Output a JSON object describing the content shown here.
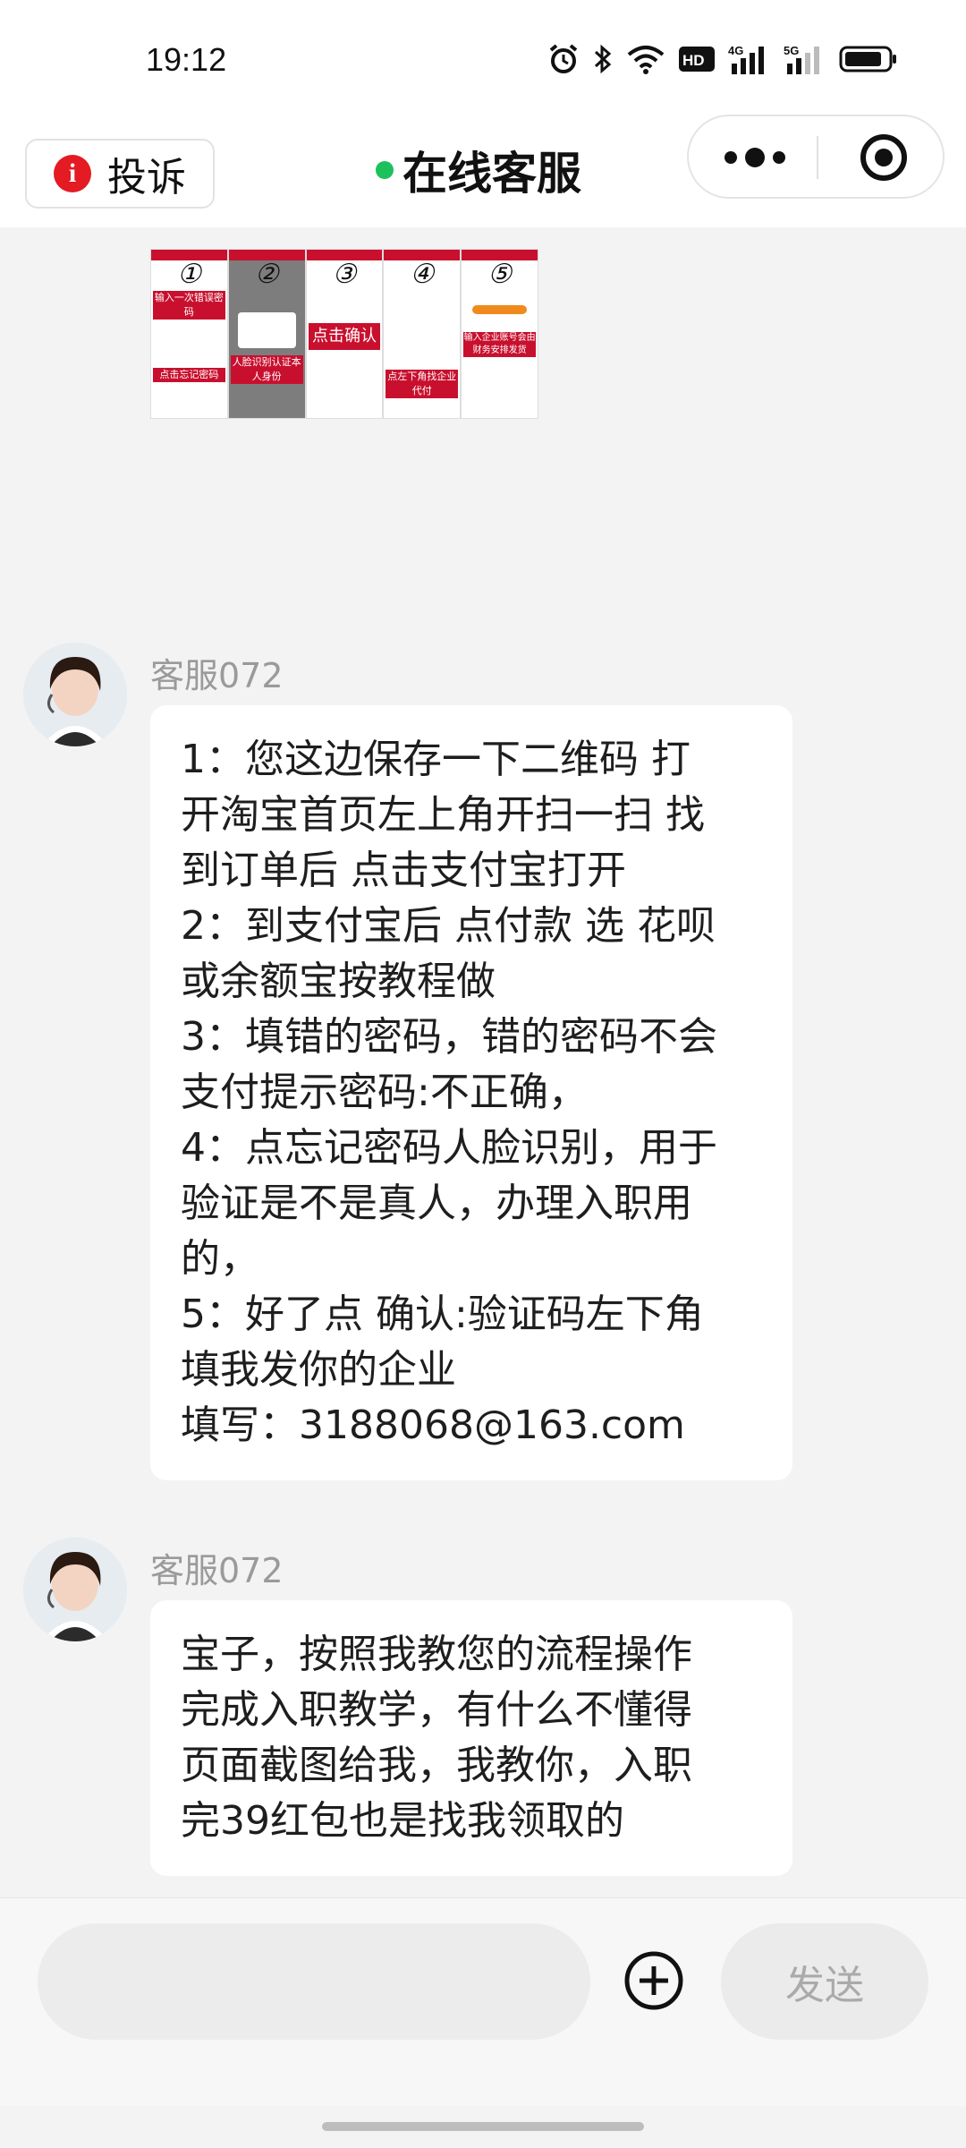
{
  "status_bar": {
    "time": "19:12",
    "icons": [
      "alarm-icon",
      "bluetooth-icon",
      "wifi-icon",
      "hd-icon",
      "signal-4g-icon",
      "signal-5g-icon",
      "battery-icon"
    ],
    "hd_label": "HD",
    "net1": "4G",
    "net2": "5G"
  },
  "header": {
    "complain_label": "投诉",
    "title": "在线客服",
    "online_color": "#1dc15b"
  },
  "tutorial_image": {
    "steps": [
      {
        "num": "①",
        "caption_top": "输入一次错误密码",
        "caption_bottom": "点击忘记密码"
      },
      {
        "num": "②",
        "caption_top": "",
        "caption_bottom": "人脸识别认证本人身份"
      },
      {
        "num": "③",
        "caption_top": "点击确认",
        "caption_bottom": ""
      },
      {
        "num": "④",
        "caption_top": "",
        "caption_bottom": "点左下角找企业代付"
      },
      {
        "num": "⑤",
        "caption_top": "输入企业账号会由财务安排发货",
        "caption_bottom": ""
      }
    ]
  },
  "messages": [
    {
      "sender": "客服072",
      "lines": [
        "1：您这边保存一下二维码 打",
        "开淘宝首页左上角开扫一扫 找",
        "到订单后 点击支付宝打开",
        "2：到支付宝后 点付款 选 花呗",
        "或余额宝按教程做",
        "3：填错的密码，错的密码不会",
        "支付提示密码:不正确，",
        "4：点忘记密码人脸识别，用于",
        "验证是不是真人，办理入职用",
        "的，",
        "5：好了点 确认:验证码左下角",
        "填我发你的企业",
        "填写：3188068@163.com"
      ]
    },
    {
      "sender": "客服072",
      "lines": [
        "宝子，按照我教您的流程操作",
        "完成入职教学，有什么不懂得",
        "页面截图给我，我教你，入职",
        "完39红包也是找我领取的"
      ]
    }
  ],
  "input_bar": {
    "placeholder": "",
    "send_label": "发送"
  }
}
